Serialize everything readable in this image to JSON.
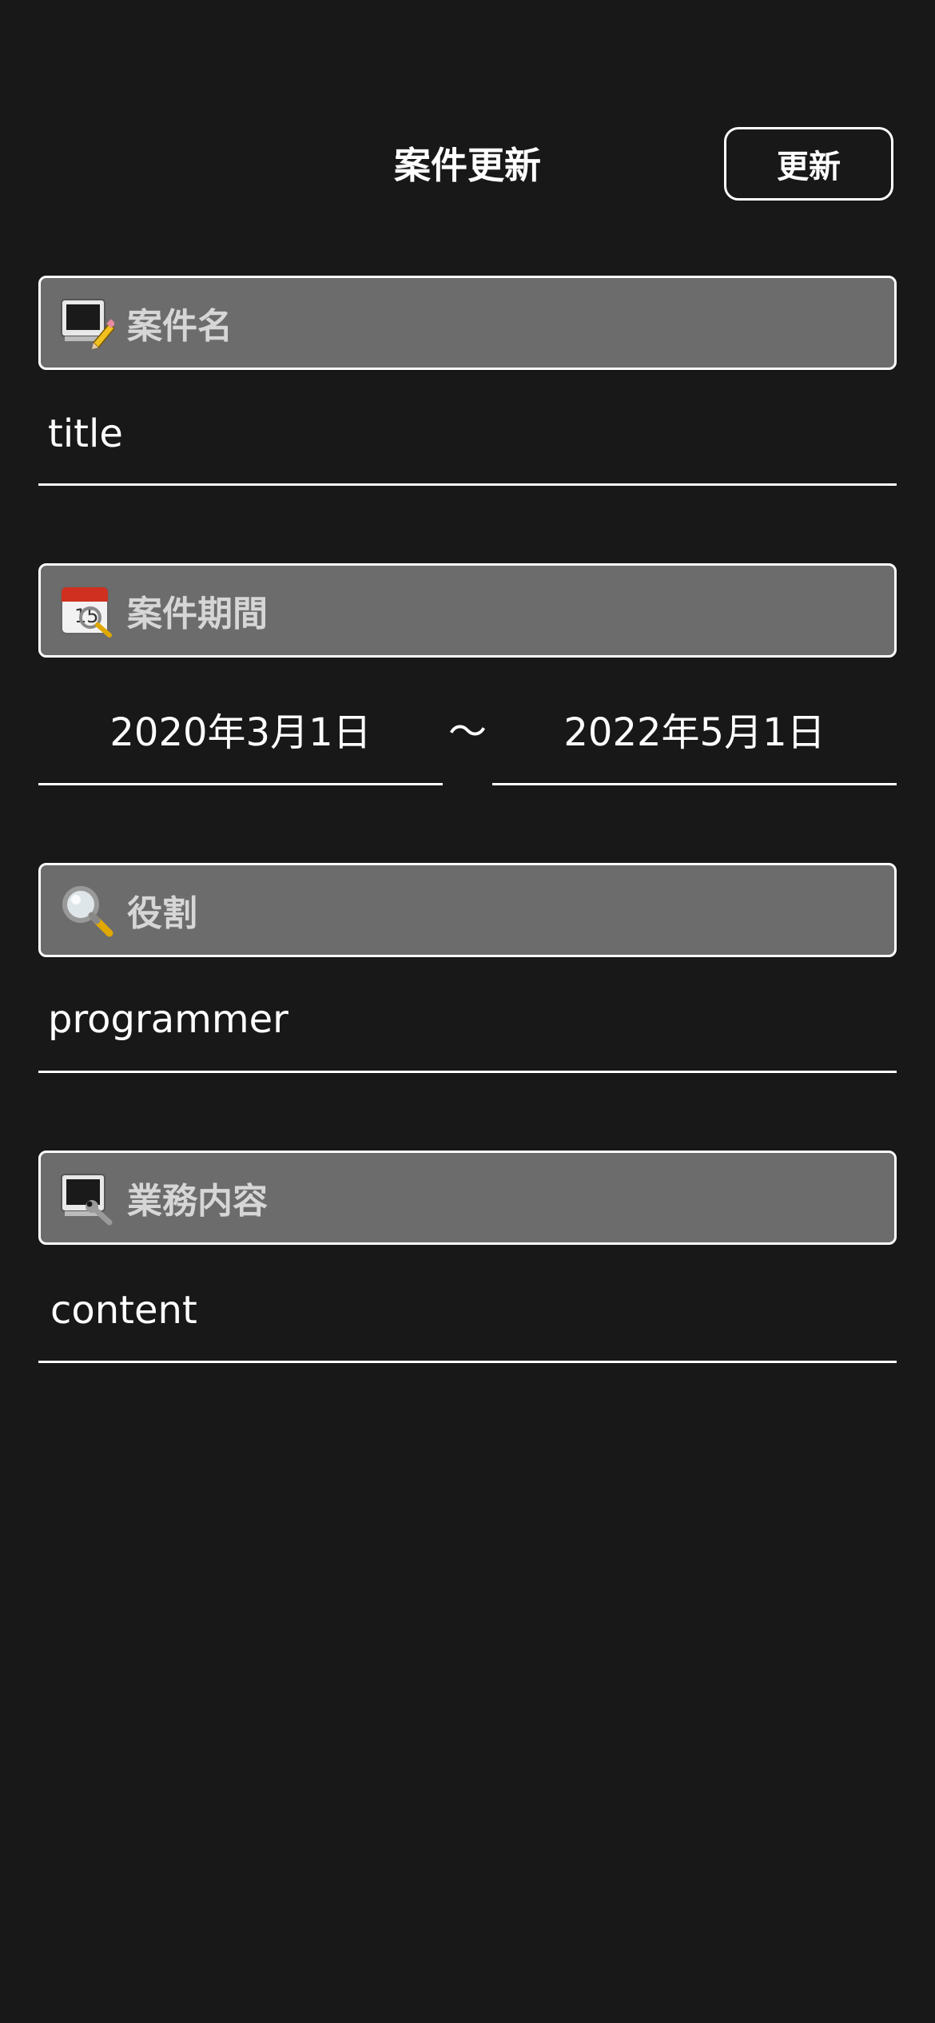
{
  "header": {
    "title": "案件更新",
    "update_label": "更新"
  },
  "sections": {
    "title": {
      "label": "案件名",
      "icon": "screen-pencil-icon",
      "value": "title"
    },
    "period": {
      "label": "案件期間",
      "icon": "calendar-magnifier-icon",
      "start": "2020年3月1日",
      "separator": "〜",
      "end": "2022年5月1日"
    },
    "role": {
      "label": "役割",
      "icon": "magnifier-icon",
      "value": "programmer"
    },
    "content": {
      "label": "業務内容",
      "icon": "screen-wrench-icon",
      "value": "content"
    }
  },
  "colors": {
    "background": "#181818",
    "section_bar": "#6c6c6c",
    "section_label": "#d6d6d6",
    "text": "#ffffff"
  }
}
